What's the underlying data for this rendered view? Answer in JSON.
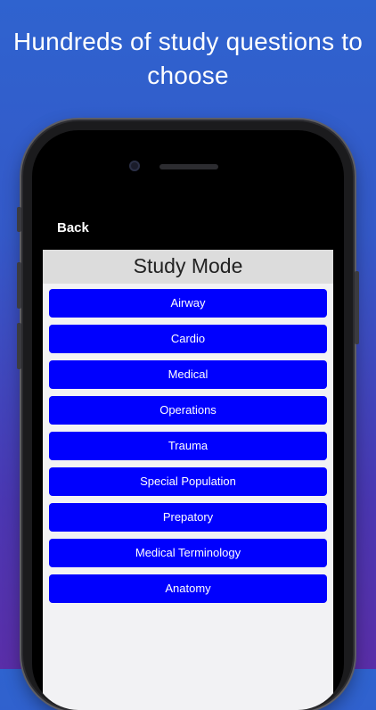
{
  "headline": {
    "line1": "Hundreds of study questions to",
    "line2": "choose"
  },
  "navbar": {
    "back_label": "Back"
  },
  "screen_title": "Study Mode",
  "categories": [
    "Airway",
    "Cardio",
    "Medical",
    "Operations",
    "Trauma",
    "Special Population",
    "Prepatory",
    "Medical Terminology",
    "Anatomy"
  ],
  "colors": {
    "button_bg": "#0000fe",
    "button_text": "#ffffff",
    "navbar_bg": "#000000",
    "title_bar_bg": "#dcdcdc",
    "background_top": "#2f63cf",
    "background_bottom": "#5a2ea8"
  }
}
